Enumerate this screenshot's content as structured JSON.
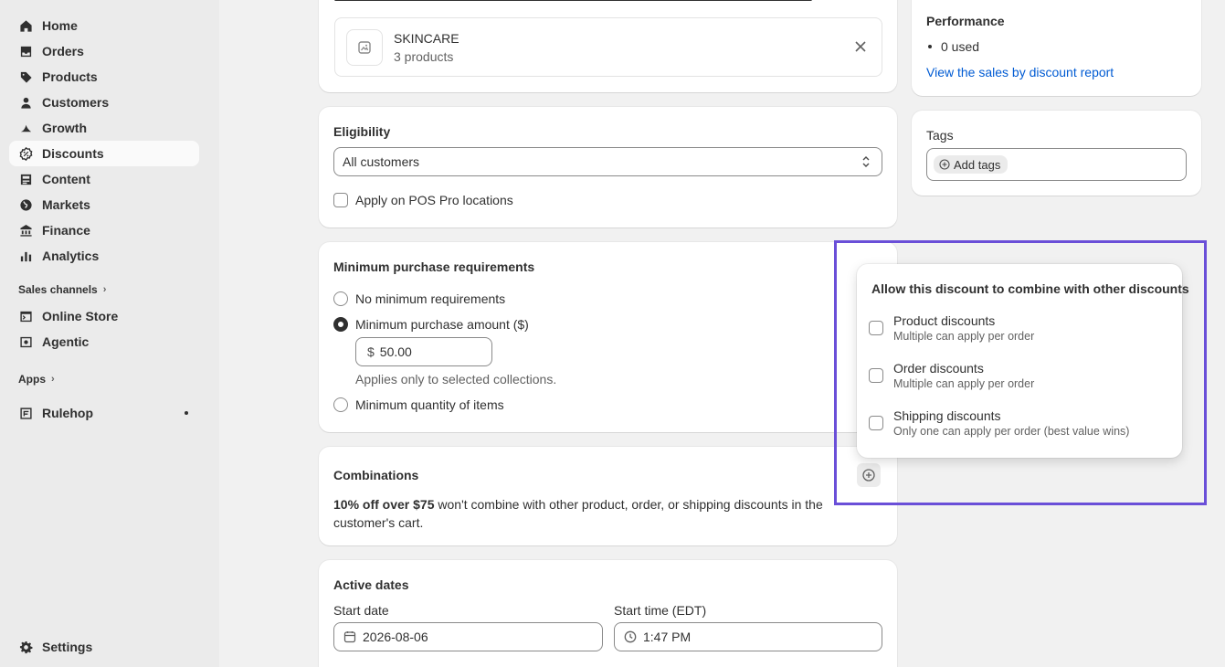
{
  "sidebar": {
    "items": [
      {
        "label": "Home",
        "icon": "home-icon"
      },
      {
        "label": "Orders",
        "icon": "orders-icon"
      },
      {
        "label": "Products",
        "icon": "tag-icon"
      },
      {
        "label": "Customers",
        "icon": "person-icon"
      },
      {
        "label": "Growth",
        "icon": "growth-icon"
      },
      {
        "label": "Discounts",
        "icon": "discount-icon",
        "active": true
      },
      {
        "label": "Content",
        "icon": "content-icon"
      },
      {
        "label": "Markets",
        "icon": "globe-icon"
      },
      {
        "label": "Finance",
        "icon": "bank-icon"
      },
      {
        "label": "Analytics",
        "icon": "bar-chart-icon"
      }
    ],
    "sales_channels_label": "Sales channels",
    "channels": [
      {
        "label": "Online Store",
        "icon": "store-icon"
      },
      {
        "label": "Agentic",
        "icon": "agentic-icon"
      }
    ],
    "apps_label": "Apps",
    "apps": [
      {
        "label": "Rulehop",
        "icon": "rulehop-icon"
      }
    ],
    "settings_label": "Settings"
  },
  "collection": {
    "name": "SKINCARE",
    "count": "3 products"
  },
  "eligibility": {
    "title": "Eligibility",
    "select_value": "All customers",
    "pos_label": "Apply on POS Pro locations"
  },
  "min_purchase": {
    "title": "Minimum purchase requirements",
    "options": [
      "No minimum requirements",
      "Minimum purchase amount ($)",
      "Minimum quantity of items"
    ],
    "selected": 1,
    "currency": "$",
    "amount": "50.00",
    "help": "Applies only to selected collections."
  },
  "combinations": {
    "title": "Combinations",
    "bold": "10% off over $75",
    "line1_rest": " won't combine with other product, order, or shipping discounts in the",
    "line2": "customer's cart."
  },
  "active_dates": {
    "title": "Active dates",
    "start_date_label": "Start date",
    "start_date": "2026-08-06",
    "start_time_label": "Start time (EDT)",
    "start_time": "1:47 PM"
  },
  "performance": {
    "title": "Performance",
    "used": "0 used",
    "report_link": "View the sales by discount report"
  },
  "tags": {
    "title": "Tags",
    "add_label": "Add tags"
  },
  "popover": {
    "title": "Allow this discount to combine with other discounts",
    "items": [
      {
        "title": "Product discounts",
        "sub": "Multiple can apply per order"
      },
      {
        "title": "Order discounts",
        "sub": "Multiple can apply per order"
      },
      {
        "title": "Shipping discounts",
        "sub": "Only one can apply per order (best value wins)"
      }
    ]
  },
  "colors": {
    "link": "#005bd3",
    "highlight": "#6a4fd8"
  }
}
